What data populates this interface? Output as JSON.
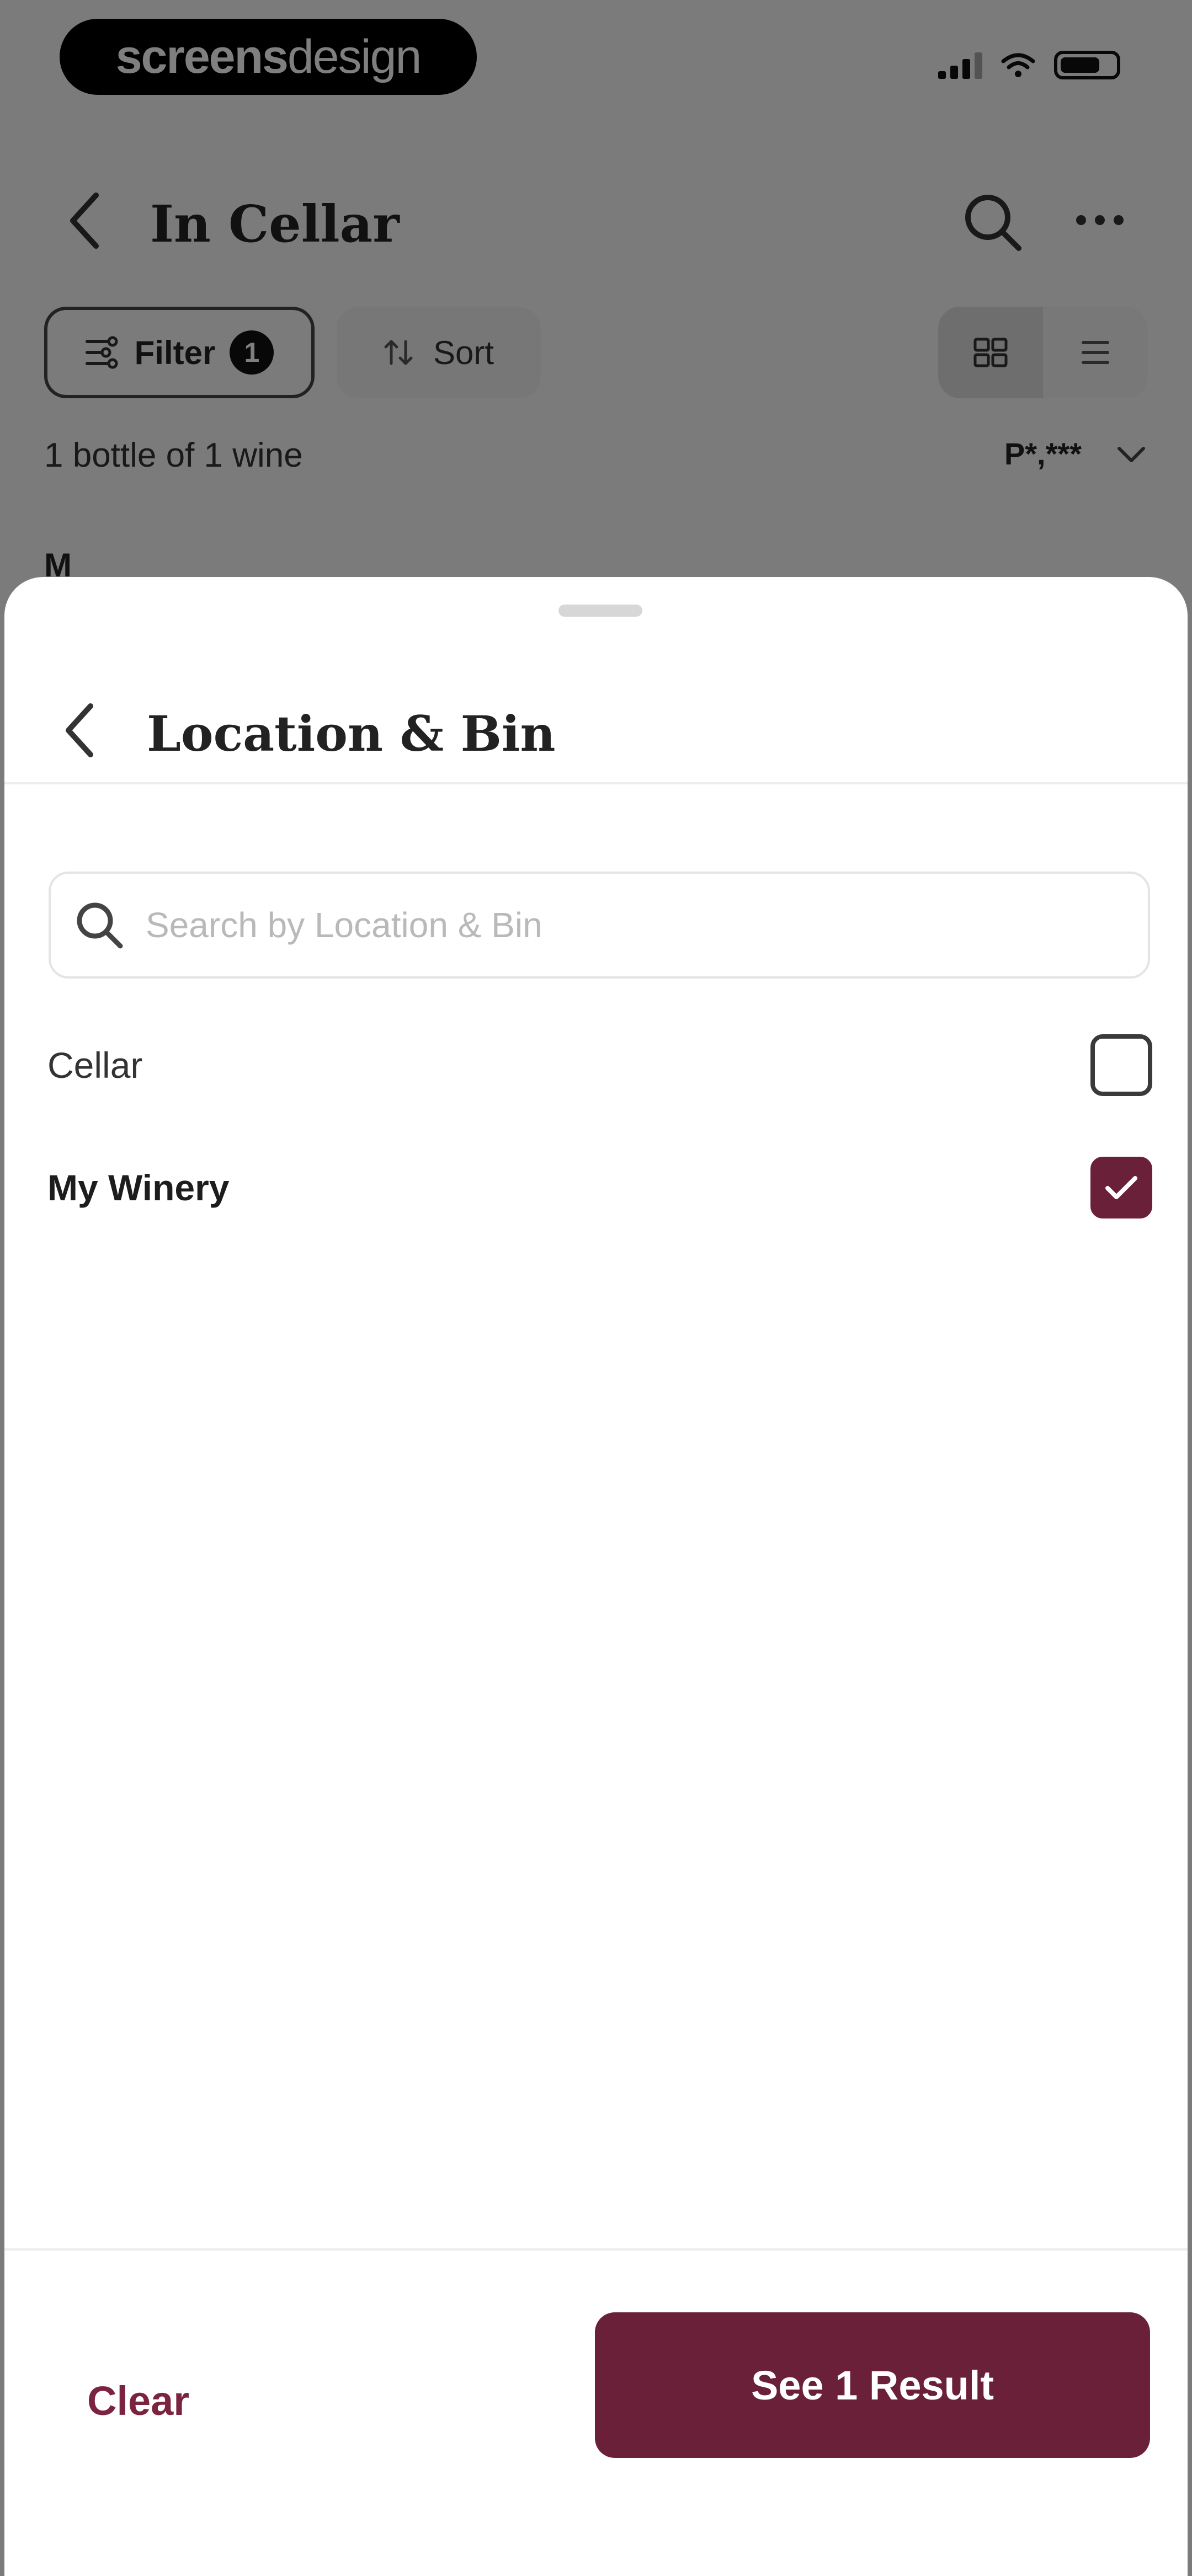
{
  "status_bar": {
    "logo_bold": "screens",
    "logo_light": "design"
  },
  "header": {
    "title": "In Cellar"
  },
  "toolbar": {
    "filter_label": "Filter",
    "filter_count": "1",
    "sort_label": "Sort"
  },
  "summary": {
    "count_text": "1 bottle of 1 wine",
    "currency_selected": "P*,***"
  },
  "list": {
    "section_letter": "M"
  },
  "sheet": {
    "title": "Location & Bin",
    "search": {
      "placeholder": "Search by Location & Bin",
      "value": ""
    },
    "options": [
      {
        "label": "Cellar",
        "checked": false
      },
      {
        "label": "My Winery",
        "checked": true
      }
    ],
    "clear_label": "Clear",
    "result_label": "See 1 Result"
  },
  "colors": {
    "accent": "#6b2039",
    "accent_text": "#7b2440"
  }
}
